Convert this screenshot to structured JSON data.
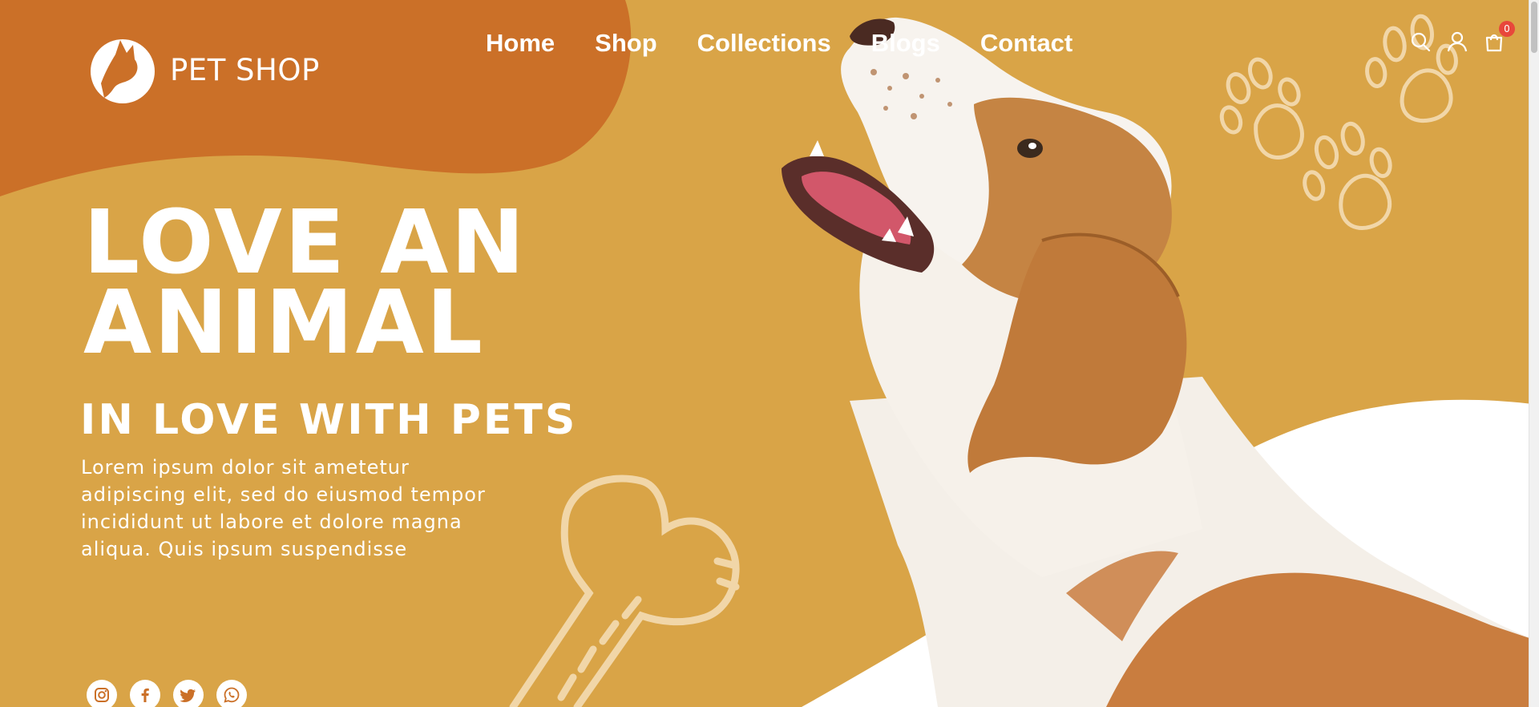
{
  "brand": {
    "name": "PET SHOP"
  },
  "nav": {
    "items": [
      {
        "label": "Home"
      },
      {
        "label": "Shop"
      },
      {
        "label": "Collections"
      },
      {
        "label": "Blogs"
      },
      {
        "label": "Contact"
      }
    ]
  },
  "header_icons": {
    "search": "search-icon",
    "account": "user-icon",
    "cart": "shopping-bag-icon",
    "cart_count": "0"
  },
  "hero": {
    "title_line1": "LOVE AN",
    "title_line2": "ANIMAL",
    "subtitle": "IN LOVE WITH PETS",
    "description": "Lorem ipsum dolor sit ametetur adipiscing elit, sed do eiusmod tempor incididunt ut labore et dolore magna aliqua. Quis ipsum suspendisse"
  },
  "social": [
    "instagram-icon",
    "facebook-icon",
    "twitter-icon",
    "whatsapp-icon"
  ],
  "colors": {
    "background": "#d9a447",
    "blob": "#cb7028",
    "accent_badge": "#e8473b",
    "paw_outline": "#f1d6a8"
  }
}
